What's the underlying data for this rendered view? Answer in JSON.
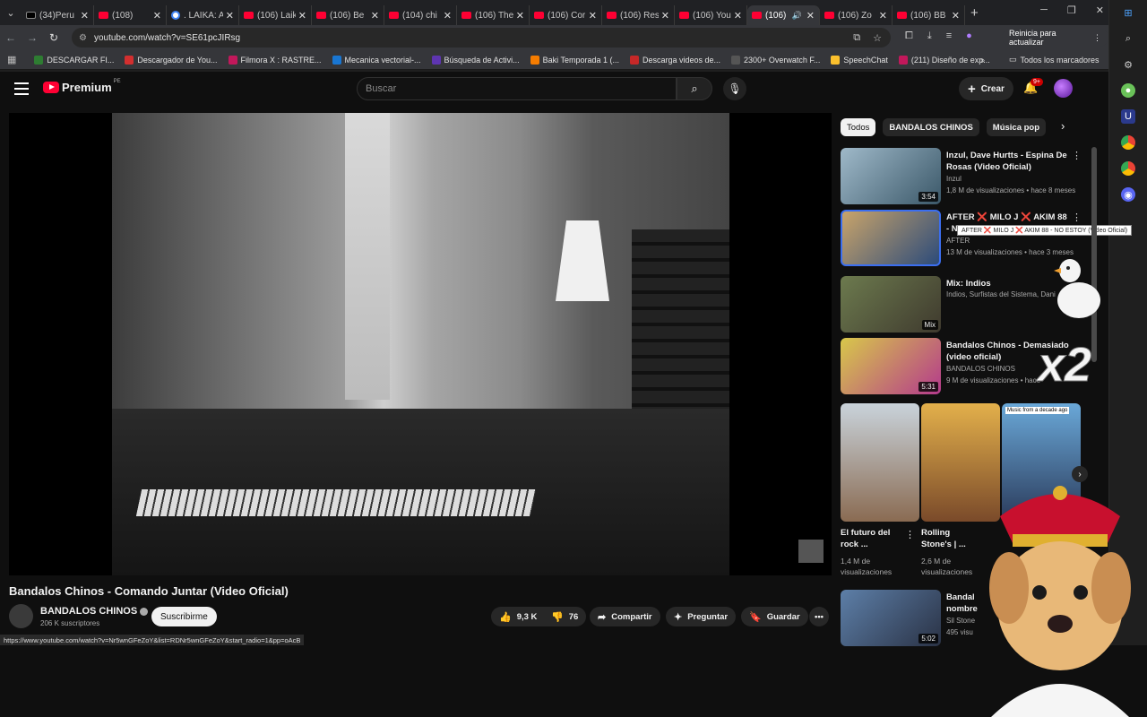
{
  "browser": {
    "tabs": [
      {
        "label": "(34)Peru",
        "icon": "x-icon"
      },
      {
        "label": "(108)",
        "icon": "youtube-icon"
      },
      {
        "label": ". LAIKA: A",
        "icon": "google-icon"
      },
      {
        "label": "(106) Laik",
        "icon": "youtube-icon"
      },
      {
        "label": "(106) Be",
        "icon": "youtube-icon"
      },
      {
        "label": "(104) chi",
        "icon": "youtube-icon"
      },
      {
        "label": "(106) The",
        "icon": "youtube-icon"
      },
      {
        "label": "(106) Cor",
        "icon": "youtube-icon"
      },
      {
        "label": "(106) Res",
        "icon": "youtube-icon"
      },
      {
        "label": "(106) You",
        "icon": "youtube-icon"
      },
      {
        "label": "(106)",
        "icon": "youtube-icon",
        "active": true
      },
      {
        "label": "(106) Zo",
        "icon": "youtube-icon"
      },
      {
        "label": "(106) BB",
        "icon": "youtube-icon"
      }
    ],
    "url": "youtube.com/watch?v=SE61pcJIRsg",
    "relaunch_label": "Reinicia para actualizar",
    "bookmarks": [
      {
        "label": "DESCARGAR FI...",
        "color": "#2e7d32"
      },
      {
        "label": "Descargador de You...",
        "color": "#d32f2f"
      },
      {
        "label": "Filmora X : RASTRE...",
        "color": "#c2185b"
      },
      {
        "label": "Mecanica vectorial-...",
        "color": "#1976d2"
      },
      {
        "label": "Búsqueda de Activi...",
        "color": "#5e35b1"
      },
      {
        "label": "Baki Temporada 1 (...",
        "color": "#f57c00"
      },
      {
        "label": "Descarga videos de...",
        "color": "#c62828"
      },
      {
        "label": "2300+ Overwatch F...",
        "color": "#555555"
      },
      {
        "label": "SpeechChat",
        "color": "#fbc02d"
      },
      {
        "label": "(211) Diseño de exp...",
        "color": "#c2185b"
      }
    ],
    "all_bookmarks_label": "Todos los marcadores",
    "status_url": "https://www.youtube.com/watch?v=Nr5wnGFeZoY&list=RDNr5wnGFeZoY&start_radio=1&pp=oAcB"
  },
  "youtube": {
    "logo_text": "Premium",
    "logo_country": "PE",
    "search_placeholder": "Buscar",
    "create_label": "Crear",
    "notif_count": "9+",
    "video": {
      "title": "Bandalos Chinos - Comando Juntar (Video Oficial)",
      "channel": "BANDALOS CHINOS",
      "subscribers": "206 K suscriptores",
      "subscribe_label": "Suscribirme",
      "likes": "9,3 K",
      "dislikes": "76",
      "share_label": "Compartir",
      "ask_label": "Preguntar",
      "save_label": "Guardar"
    },
    "chips": [
      "Todos",
      "BANDALOS CHINOS",
      "Música pop"
    ],
    "recommendations": [
      {
        "title": "Inzul, Dave Hurtts - Espina De Rosas (Video Oficial)",
        "channel": "Inzul",
        "meta": "1,8 M de visualizaciones • hace 8 meses",
        "duration": "3:54"
      },
      {
        "title": "AFTER ❌ MILO J ❌ AKIM 88 - NO ESTOY (Video Oficial)",
        "channel": "AFTER",
        "meta": "13 M de visualizaciones • hace 3 meses",
        "duration": ""
      },
      {
        "title": "Mix: Indios",
        "channel": "Indios, Surfistas del Sistema, Dani",
        "meta": "",
        "duration": "Mix"
      },
      {
        "title": "Bandalos Chinos - Demasiado (video oficial)",
        "channel": "BANDALOS CHINOS",
        "meta": "9 M de visualizaciones • hace",
        "duration": "5:31"
      }
    ],
    "tooltip": "AFTER ❌ MILO J ❌ AKIM 88 - NO ESTOY (Video Oficial)",
    "shorts": [
      {
        "title": "El futuro del rock ...",
        "views": "1,4 M de visualizaciones",
        "thumb_caption": ""
      },
      {
        "title": "Rolling Stone's | ...",
        "views": "2,6 M de visualizaciones",
        "thumb_caption": ""
      },
      {
        "title": "",
        "views": "",
        "thumb_caption": "Music from a decade ago"
      }
    ],
    "next_rec": {
      "title": "Bandal nombre",
      "channel": "Sil Stone",
      "meta": "495 visu",
      "duration": "5:02"
    },
    "overlay_text": "x2"
  },
  "colors": {
    "accent": "#ff0033",
    "background": "#0f0f0f"
  }
}
